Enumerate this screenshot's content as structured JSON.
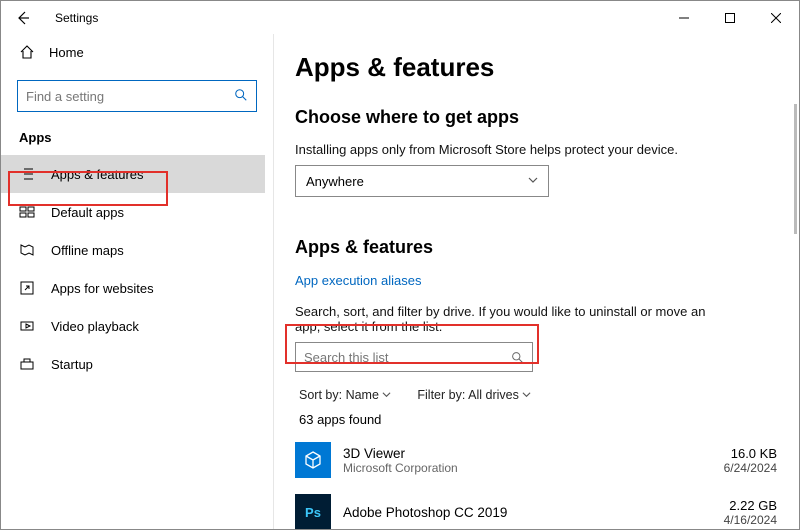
{
  "window": {
    "title": "Settings"
  },
  "sidebar": {
    "home": "Home",
    "search_placeholder": "Find a setting",
    "category": "Apps",
    "items": [
      {
        "label": "Apps & features"
      },
      {
        "label": "Default apps"
      },
      {
        "label": "Offline maps"
      },
      {
        "label": "Apps for websites"
      },
      {
        "label": "Video playback"
      },
      {
        "label": "Startup"
      }
    ]
  },
  "main": {
    "heading": "Apps & features",
    "choose_heading": "Choose where to get apps",
    "choose_desc": "Installing apps only from Microsoft Store helps protect your device.",
    "choose_value": "Anywhere",
    "list_heading": "Apps & features",
    "alias_link": "App execution aliases",
    "list_desc": "Search, sort, and filter by drive. If you would like to uninstall or move an app, select it from the list.",
    "list_search_placeholder": "Search this list",
    "sort_label": "Sort by:",
    "sort_value": "Name",
    "filter_label": "Filter by:",
    "filter_value": "All drives",
    "count": "63 apps found",
    "apps": [
      {
        "name": "3D Viewer",
        "publisher": "Microsoft Corporation",
        "size": "16.0 KB",
        "date": "6/24/2024"
      },
      {
        "name": "Adobe Photoshop CC 2019",
        "publisher": "",
        "size": "2.22 GB",
        "date": "4/16/2024"
      }
    ]
  }
}
